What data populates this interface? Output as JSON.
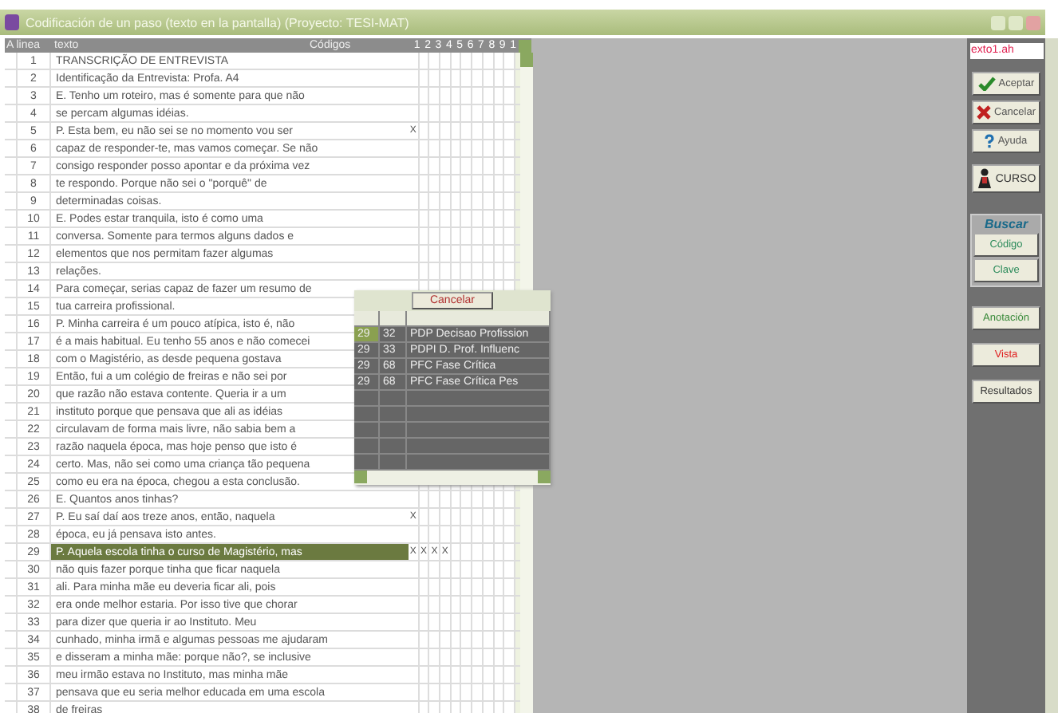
{
  "window": {
    "title": "Codificación de un paso (texto en la pantalla) (Proyecto: TESI-MAT)"
  },
  "table": {
    "line_header": "A linea",
    "text_header": "texto",
    "codes_header": "Códigos",
    "code_columns": [
      "1",
      "2",
      "3",
      "4",
      "5",
      "6",
      "7",
      "8",
      "9",
      "1"
    ],
    "rows": [
      {
        "number": "1",
        "text": "TRANSCRIÇÃO DE ENTREVISTA",
        "selected": false
      },
      {
        "number": "2",
        "text": "Identificação da Entrevista: Profa. A4",
        "selected": false
      },
      {
        "number": "3",
        "text": "E. Tenho um roteiro, mas é somente para que não",
        "selected": false
      },
      {
        "number": "4",
        "text": "se percam algumas idéias.",
        "selected": false
      },
      {
        "number": "5",
        "text": "P. Esta bem, eu não sei se no momento vou ser",
        "selected": false,
        "marks": [
          "X"
        ]
      },
      {
        "number": "6",
        "text": "capaz de responder-te, mas vamos começar. Se não",
        "selected": false
      },
      {
        "number": "7",
        "text": "consigo responder posso apontar e da próxima vez",
        "selected": false
      },
      {
        "number": "8",
        "text": "te respondo. Porque não sei o \"porquê\" de",
        "selected": false
      },
      {
        "number": "9",
        "text": "determinadas coisas.",
        "selected": false
      },
      {
        "number": "10",
        "text": "E. Podes estar tranquila, isto é como uma",
        "selected": false
      },
      {
        "number": "11",
        "text": "conversa. Somente para termos alguns dados e",
        "selected": false
      },
      {
        "number": "12",
        "text": "elementos que nos permitam fazer algumas",
        "selected": false
      },
      {
        "number": "13",
        "text": "relações.",
        "selected": false
      },
      {
        "number": "14",
        "text": "Para começar, serias capaz de fazer um resumo de",
        "selected": false
      },
      {
        "number": "15",
        "text": "tua carreira profissional.",
        "selected": false
      },
      {
        "number": "16",
        "text": "P. Minha carreira é um pouco atípica, isto é, não",
        "selected": false
      },
      {
        "number": "17",
        "text": "é a mais habitual. Eu tenho 55 anos e não comecei",
        "selected": false
      },
      {
        "number": "18",
        "text": "com o Magistério, as desde pequena gostava",
        "selected": false
      },
      {
        "number": "19",
        "text": "Então, fui a um colégio de freiras e não sei por",
        "selected": false
      },
      {
        "number": "20",
        "text": "que razão não estava contente. Queria ir a um",
        "selected": false
      },
      {
        "number": "21",
        "text": "instituto porque que pensava que ali as idéias",
        "selected": false
      },
      {
        "number": "22",
        "text": "circulavam de forma mais livre, não sabia bem a",
        "selected": false
      },
      {
        "number": "23",
        "text": "razão naquela época, mas hoje penso que isto é",
        "selected": false
      },
      {
        "number": "24",
        "text": "certo. Mas, não sei como uma criança tão pequena",
        "selected": false
      },
      {
        "number": "25",
        "text": "como eu era na época, chegou a esta conclusão.",
        "selected": false
      },
      {
        "number": "26",
        "text": "E. Quantos anos tinhas?",
        "selected": false
      },
      {
        "number": "27",
        "text": "P. Eu saí daí aos treze anos, então, naquela",
        "selected": false,
        "marks": [
          "X"
        ]
      },
      {
        "number": "28",
        "text": "época, eu já pensava isto antes.",
        "selected": false
      },
      {
        "number": "29",
        "text": "P. Aquela escola tinha o curso de Magistério, mas",
        "selected": true,
        "marks": [
          "X",
          "X",
          "X",
          "X"
        ]
      },
      {
        "number": "30",
        "text": "não quis fazer porque tinha que ficar naquela",
        "selected": false
      },
      {
        "number": "31",
        "text": "ali. Para minha mãe eu deveria ficar ali, pois",
        "selected": false
      },
      {
        "number": "32",
        "text": "era onde melhor estaria. Por isso tive que chorar",
        "selected": false
      },
      {
        "number": "33",
        "text": "para dizer que queria ir ao Instituto. Meu",
        "selected": false
      },
      {
        "number": "34",
        "text": "cunhado, minha irmã e algumas pessoas me ajudaram",
        "selected": false
      },
      {
        "number": "35",
        "text": "e disseram a minha mãe: porque não?, se inclusive",
        "selected": false
      },
      {
        "number": "36",
        "text": "meu irmão estava no Instituto, mas minha mãe",
        "selected": false
      },
      {
        "number": "37",
        "text": "pensava que eu seria melhor educada em uma escola",
        "selected": false
      },
      {
        "number": "38",
        "text": "de freiras",
        "selected": false
      }
    ]
  },
  "popup": {
    "cancel_button": "Cancelar",
    "rows": [
      {
        "line": "29",
        "code": "32",
        "name": "PDP Decisao Profission",
        "selected": true
      },
      {
        "line": "29",
        "code": "33",
        "name": "PDPI D. Prof. Influenc",
        "selected": false
      },
      {
        "line": "29",
        "code": "68",
        "name": "PFC Fase Crítica",
        "selected": false
      },
      {
        "line": "29",
        "code": "68",
        "name": "PFC Fase Crítica Pes",
        "selected": false
      }
    ]
  },
  "sidebar": {
    "file_field": {
      "value": "exto1.ah"
    },
    "actions": [
      {
        "label": "Aceptar"
      },
      {
        "label": "Cancelar"
      },
      {
        "label": "Ayuda"
      }
    ],
    "course_button": {
      "label": "CURSO"
    },
    "search": {
      "title": "Buscar",
      "buttons": [
        {
          "label": "Código"
        },
        {
          "label": "Clave"
        }
      ]
    },
    "tools": [
      {
        "label": "Anotación",
        "color": "#3a8a3a"
      },
      {
        "label": "Vista",
        "color": "#e02020"
      },
      {
        "label": "Resultados",
        "color": "#333333"
      }
    ]
  }
}
